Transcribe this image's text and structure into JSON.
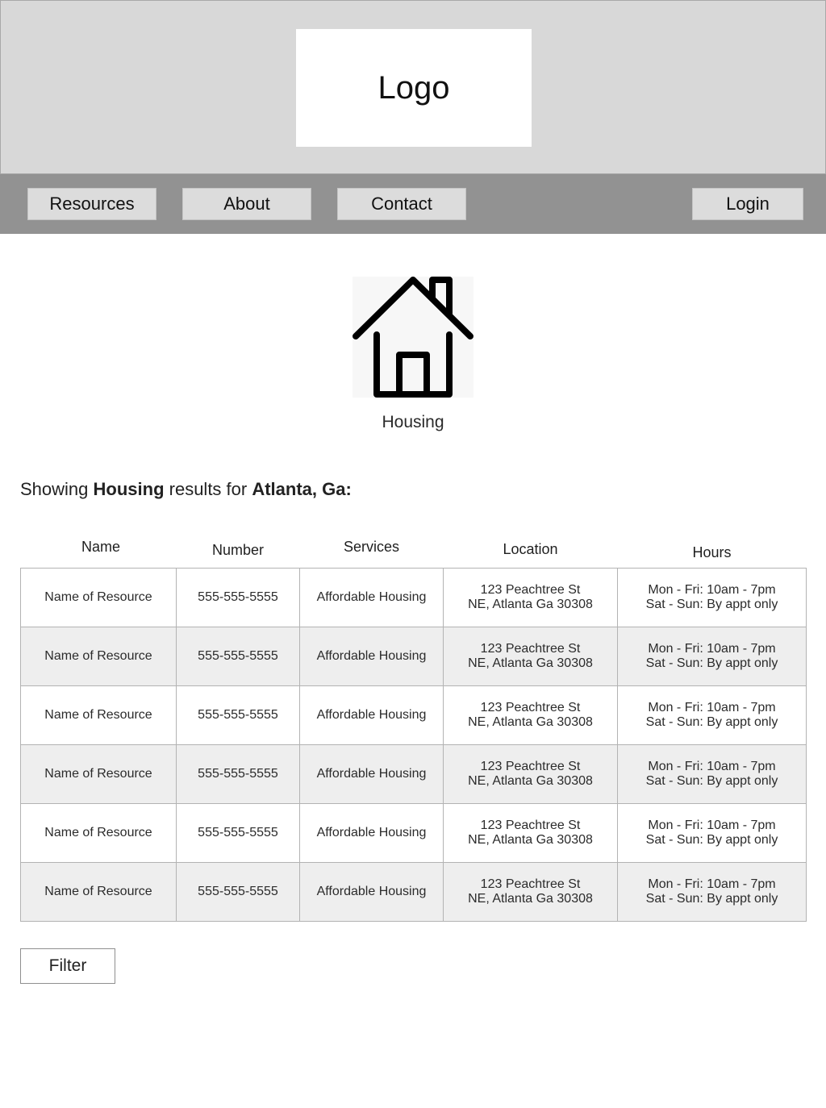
{
  "header": {
    "logo_text": "Logo"
  },
  "nav": {
    "resources": "Resources",
    "about": "About",
    "contact": "Contact",
    "login": "Login"
  },
  "category": {
    "icon": "house-icon",
    "label": "Housing"
  },
  "results": {
    "prefix": "Showing ",
    "category": "Housing",
    "middle": " results for ",
    "location": "Atlanta, Ga:"
  },
  "table": {
    "columns": [
      "Name",
      "Number",
      "Services",
      "Location",
      "Hours"
    ],
    "rows": [
      {
        "name": "Name of Resource",
        "number": "555-555-5555",
        "services": "Affordable Housing",
        "location_line1": "123 Peachtree St",
        "location_line2": "NE, Atlanta Ga 30308",
        "hours_line1": "Mon - Fri: 10am - 7pm",
        "hours_line2": "Sat - Sun: By appt only"
      },
      {
        "name": "Name of Resource",
        "number": "555-555-5555",
        "services": "Affordable Housing",
        "location_line1": "123 Peachtree St",
        "location_line2": "NE, Atlanta Ga 30308",
        "hours_line1": "Mon - Fri: 10am - 7pm",
        "hours_line2": "Sat - Sun: By appt only"
      },
      {
        "name": "Name of Resource",
        "number": "555-555-5555",
        "services": "Affordable Housing",
        "location_line1": "123 Peachtree St",
        "location_line2": "NE, Atlanta Ga 30308",
        "hours_line1": "Mon - Fri: 10am - 7pm",
        "hours_line2": "Sat - Sun: By appt only"
      },
      {
        "name": "Name of Resource",
        "number": "555-555-5555",
        "services": "Affordable Housing",
        "location_line1": "123 Peachtree St",
        "location_line2": "NE, Atlanta Ga 30308",
        "hours_line1": "Mon - Fri: 10am - 7pm",
        "hours_line2": "Sat - Sun: By appt only"
      },
      {
        "name": "Name of Resource",
        "number": "555-555-5555",
        "services": "Affordable Housing",
        "location_line1": "123 Peachtree St",
        "location_line2": "NE, Atlanta Ga 30308",
        "hours_line1": "Mon - Fri: 10am - 7pm",
        "hours_line2": "Sat - Sun: By appt only"
      },
      {
        "name": "Name of Resource",
        "number": "555-555-5555",
        "services": "Affordable Housing",
        "location_line1": "123 Peachtree St",
        "location_line2": "NE, Atlanta Ga 30308",
        "hours_line1": "Mon - Fri: 10am - 7pm",
        "hours_line2": "Sat - Sun: By appt only"
      }
    ]
  },
  "filter": {
    "label": "Filter"
  },
  "colors": {
    "header_bg": "#d8d8d8",
    "nav_bg": "#929292",
    "button_bg": "#dcdcdc",
    "row_alt_bg": "#eeeeee"
  }
}
